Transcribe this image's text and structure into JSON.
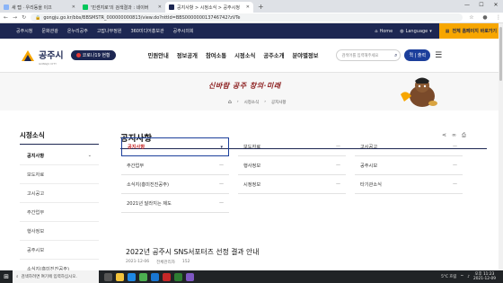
{
  "browser": {
    "tabs": [
      {
        "title": "새 탭 · 우리동을 이끄"
      },
      {
        "title": "'민센지로'의 검색결과 : 네이버"
      },
      {
        "title": "공지사항 > 시정소식 > 공주시청"
      }
    ],
    "new_tab": "+",
    "url": "gongju.go.kr/bbs/BBSMSTR_000000000813/view.do?nttId=BBS000000013746742?zVTe"
  },
  "topbar": {
    "links": [
      "공주시청",
      "문화관광",
      "온누리공주",
      "고맙나무정원",
      "360미디어홍보관",
      "공주시의회"
    ],
    "home": "Home",
    "language": "Language",
    "call": "전체 홈페이지 바로가기"
  },
  "header": {
    "logo_name": "공주시",
    "logo_sub": "GONGJU CITY",
    "covid_label": "코로나19 현황",
    "gnb": [
      "민원안내",
      "정보공개",
      "참여소통",
      "시정소식",
      "공주소개",
      "분야별정보"
    ],
    "search_placeholder": "검색어를 입력해주세요",
    "quick_label": "퀵 | 출력"
  },
  "visual": {
    "slogan": "신바람 공주 창의·미래",
    "breadcrumb": [
      "시정소식",
      "공지사항"
    ]
  },
  "lnb": {
    "title": "시정소식",
    "items": [
      {
        "label": "공지사항",
        "active": true
      },
      {
        "label": "보도자료"
      },
      {
        "label": "고시공고"
      },
      {
        "label": "주간업무"
      },
      {
        "label": "행사정보"
      },
      {
        "label": "공주시보"
      },
      {
        "label": "소식지(흥미진진공주)"
      }
    ]
  },
  "page": {
    "title": "공지사항",
    "categories": [
      "공지사항",
      "보도자료",
      "고시공고",
      "주간업무",
      "행사정보",
      "공주시보",
      "소식지(흥미진진공주)",
      "시정정보",
      "타기관소식",
      "2021년 달라지는 제도"
    ],
    "post_title": "2022년 공주시 SNS서포터즈 선정 결과 안내",
    "post_date": "2021-12-06",
    "post_author": "전체관리자",
    "post_views": "152"
  },
  "taskbar": {
    "search": "검색하려면 여기에 입력하십시오.",
    "weather": "5°C 흐림",
    "time": "오후 11:23",
    "date": "2021-12-09"
  },
  "colors": {
    "navy": "#1d2752",
    "accent": "#f7a600",
    "selected": "#c62828"
  }
}
